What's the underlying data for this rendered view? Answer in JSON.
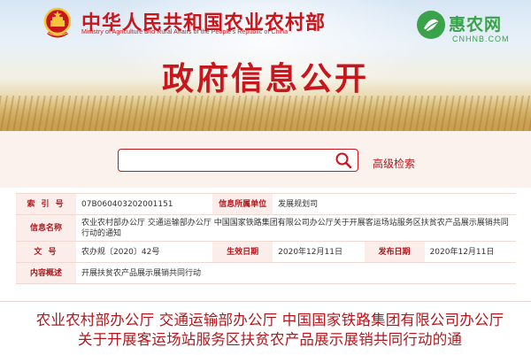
{
  "header": {
    "ministry_cn": "中华人民共和国农业农村部",
    "ministry_en": "Ministry of Agriculture and Rural Affairs of the People's Republic of China",
    "banner_title": "政府信息公开",
    "site_logo_name": "惠农网",
    "site_logo_domain": "CNHNB.COM",
    "colors": {
      "brand_red": "#c8161d",
      "logo_green": "#3aa24a"
    }
  },
  "search": {
    "placeholder": "",
    "value": "",
    "advanced_label": "高级检索",
    "icon": "search-icon"
  },
  "info": {
    "index_label": "索 引 号",
    "index_value": "07B060403202001151",
    "org_label": "信息所属单位",
    "org_value": "发展规划司",
    "name_label": "信息名称",
    "name_value": "农业农村部办公厅 交通运输部办公厅 中国国家铁路集团有限公司办公厅关于开展客运场站服务区扶贫农产品展示展销共同行动的通知",
    "doc_label": "文 号",
    "doc_value": "农办规〔2020〕42号",
    "effective_label": "生效日期",
    "effective_value": "2020年12月11日",
    "publish_label": "发布日期",
    "publish_value": "2020年12月11日",
    "summary_label": "内容概述",
    "summary_value": "开展扶贫农产品展示展销共同行动"
  },
  "article": {
    "title": "农业农村部办公厅 交通运输部办公厅 中国国家铁路集团有限公司办公厅关于开展客运场站服务区扶贫农产品展示展销共同行动的通"
  }
}
